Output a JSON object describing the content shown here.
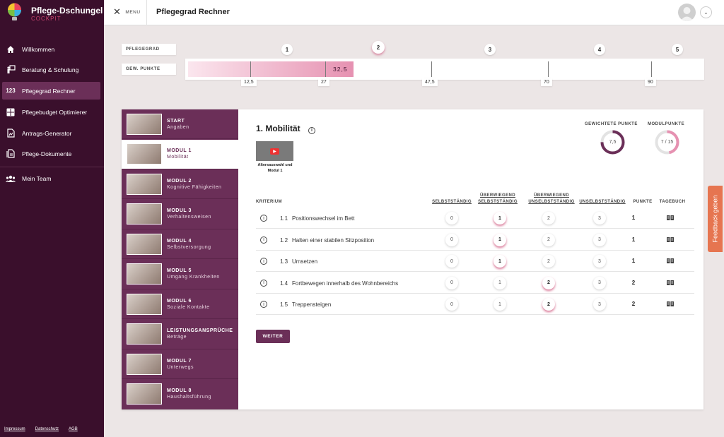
{
  "app": {
    "name": "Pflege-Dschungel",
    "subtitle": "COCKPIT"
  },
  "sidebar": {
    "items": [
      {
        "label": "Willkommen",
        "icon": "home-icon"
      },
      {
        "label": "Beratung & Schulung",
        "icon": "presentation-icon"
      },
      {
        "label": "Pflegegrad Rechner",
        "icon": "numbers-icon",
        "active": true
      },
      {
        "label": "Pflegebudget Optimierer",
        "icon": "calculator-icon"
      },
      {
        "label": "Antrags-Generator",
        "icon": "document-generator-icon"
      },
      {
        "label": "Pflege-Dokumente",
        "icon": "documents-icon"
      }
    ],
    "team": {
      "label": "Mein Team",
      "icon": "team-icon"
    },
    "footer": [
      "Impressum",
      "Datenschutz",
      "AGB"
    ]
  },
  "topbar": {
    "menu_label": "MENU",
    "title": "Pflegegrad Rechner"
  },
  "pflegegrad": {
    "label": "PFLEGEGRAD",
    "points_label": "GEW. PUNKTE",
    "grades": [
      "1",
      "2",
      "3",
      "4",
      "5"
    ],
    "active_grade": "2",
    "current_points_text": "32,5",
    "current_points": 32.5,
    "ticks": [
      "12,5",
      "27",
      "47,5",
      "70",
      "90"
    ]
  },
  "modules": [
    {
      "title": "START",
      "subtitle": "Angaben"
    },
    {
      "title": "MODUL 1",
      "subtitle": "Mobilität",
      "active": true
    },
    {
      "title": "MODUL 2",
      "subtitle": "Kognitive Fähigkeiten"
    },
    {
      "title": "MODUL 3",
      "subtitle": "Verhaltensweisen"
    },
    {
      "title": "MODUL 4",
      "subtitle": "Selbstversorgung"
    },
    {
      "title": "MODUL 5",
      "subtitle": "Umgang Krankheiten"
    },
    {
      "title": "MODUL 6",
      "subtitle": "Soziale Kontakte"
    },
    {
      "title": "LEISTUNGSANSPRÜCHE",
      "subtitle": "Beträge"
    },
    {
      "title": "MODUL 7",
      "subtitle": "Unterwegs"
    },
    {
      "title": "MODUL 8",
      "subtitle": "Haushaltsführung"
    }
  ],
  "module": {
    "heading": "1. Mobilität",
    "video_logo": "Pflege-Dschungel COCKPIT",
    "video_caption": "Altersauswahl und Modul 1",
    "weighted_label": "GEWICHTETE PUNKTE",
    "weighted_value": "7,5",
    "weighted_fraction": 0.75,
    "module_points_label": "MODULPUNKTE",
    "module_points_value": "7 / 15",
    "module_points_fraction": 0.4667,
    "columns": {
      "criterion": "KRITERIUM",
      "c0": "SELBSTSTÄNDIG",
      "c1a": "ÜBERWIEGEND",
      "c1b": "SELBSTSTÄNDIG",
      "c2a": "ÜBERWIEGEND",
      "c2b": "UNSELBSTSTÄNDIG",
      "c3": "UNSELBSTSTÄNDIG",
      "points": "PUNKTE",
      "diary": "TAGEBUCH"
    },
    "rows": [
      {
        "num": "1.1",
        "label": "Positionswechsel im Bett",
        "options": [
          "0",
          "1",
          "2",
          "3"
        ],
        "selected": 1,
        "points": "1"
      },
      {
        "num": "1.2",
        "label": "Halten einer stabilen Sitzposition",
        "options": [
          "0",
          "1",
          "2",
          "3"
        ],
        "selected": 1,
        "points": "1"
      },
      {
        "num": "1.3",
        "label": "Umsetzen",
        "options": [
          "0",
          "1",
          "2",
          "3"
        ],
        "selected": 1,
        "points": "1"
      },
      {
        "num": "1.4",
        "label": "Fortbewegen innerhalb des Wohnbereichs",
        "options": [
          "0",
          "1",
          "2",
          "3"
        ],
        "selected": 2,
        "points": "2"
      },
      {
        "num": "1.5",
        "label": "Treppensteigen",
        "options": [
          "0",
          "1",
          "2",
          "3"
        ],
        "selected": 2,
        "points": "2"
      }
    ],
    "next_button": "WEITER"
  },
  "feedback": "Feedback geben",
  "colors": {
    "primary": "#6b2f58",
    "sidebar": "#3a0f2c",
    "accent": "#c9446f",
    "feedback": "#e67550"
  }
}
